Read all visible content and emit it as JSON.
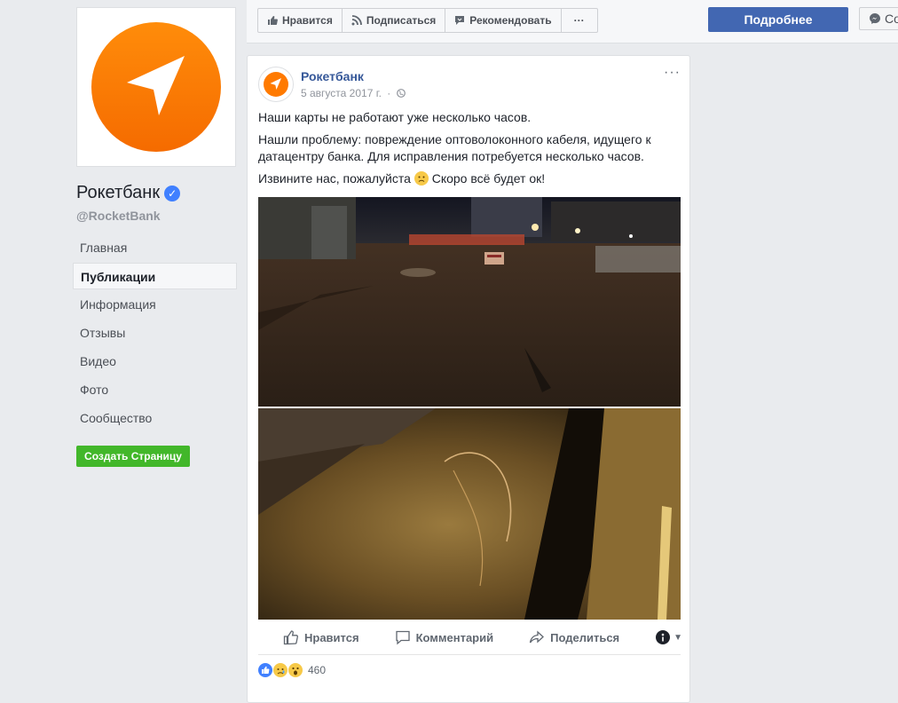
{
  "topbar": {
    "like_label": "Нравится",
    "subscribe_label": "Подписаться",
    "recommend_label": "Рекомендовать",
    "more_label": "···",
    "details_label": "Подробнее",
    "message_label": "Со"
  },
  "sidebar": {
    "page_name": "Рокетбанк",
    "page_handle": "@RocketBank",
    "items": [
      {
        "label": "Главная"
      },
      {
        "label": "Публикации"
      },
      {
        "label": "Информация"
      },
      {
        "label": "Отзывы"
      },
      {
        "label": "Видео"
      },
      {
        "label": "Фото"
      },
      {
        "label": "Сообщество"
      }
    ],
    "active_item": "Публикации",
    "create_page_label": "Создать Страницу"
  },
  "post": {
    "author": "Рокетбанк",
    "date": "5 августа 2017 г.",
    "separator": "·",
    "more_label": "···",
    "paragraphs": [
      "Наши карты не работают уже несколько часов.",
      "Нашли проблему: повреждение оптоволоконного кабеля, идущего к датацентру банка. Для исправления потребуется несколько часов.",
      "Извините нас, пожалуйста"
    ],
    "apology_suffix": "Скоро всё будет ок!",
    "actions": {
      "like": "Нравится",
      "comment": "Комментарий",
      "share": "Поделиться"
    },
    "reaction_count": "460"
  },
  "colors": {
    "brand_orange": "#ff7a00",
    "facebook_blue": "#4267b2",
    "link_blue": "#365899",
    "green": "#42b72a"
  },
  "icons": [
    "thumbs-up-icon",
    "rss-icon",
    "recommend-icon",
    "more-icon",
    "messenger-icon",
    "verified-icon",
    "globe-icon",
    "comment-icon",
    "share-icon",
    "reaction-selector-icon"
  ]
}
